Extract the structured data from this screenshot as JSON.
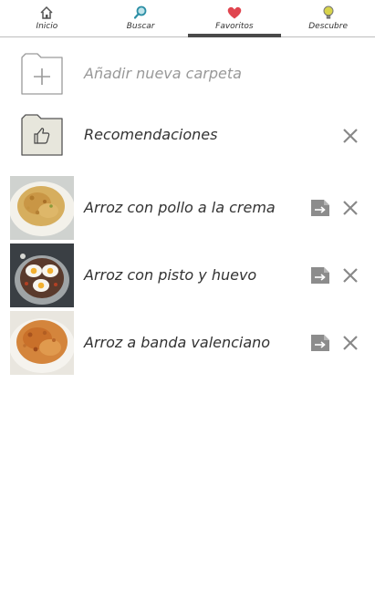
{
  "tabs": [
    {
      "id": "inicio",
      "label": "Inicio",
      "icon": "home-icon",
      "active": false
    },
    {
      "id": "buscar",
      "label": "Buscar",
      "icon": "search-icon",
      "active": false
    },
    {
      "id": "favoritos",
      "label": "Favoritos",
      "icon": "heart-icon",
      "active": true
    },
    {
      "id": "descubre",
      "label": "Descubre",
      "icon": "lightbulb-icon",
      "active": false
    }
  ],
  "add_folder": {
    "label": "Añadir nueva carpeta",
    "icon": "add-folder-icon"
  },
  "recommendations": {
    "label": "Recomendaciones",
    "icon": "thumbs-up-folder-icon"
  },
  "recipes": [
    {
      "title": "Arroz con pollo a la crema",
      "image": "arroz-con-pollo-photo"
    },
    {
      "title": "Arroz con pisto y huevo",
      "image": "arroz-con-pisto-photo"
    },
    {
      "title": "Arroz a banda valenciano",
      "image": "arroz-a-banda-photo"
    }
  ],
  "colors": {
    "heart": "#e0454f",
    "search": "#2c8fa5",
    "bulb": "#c9c43c",
    "active_tab_bar": "#4a4a4a",
    "icon_grey": "#888888"
  }
}
